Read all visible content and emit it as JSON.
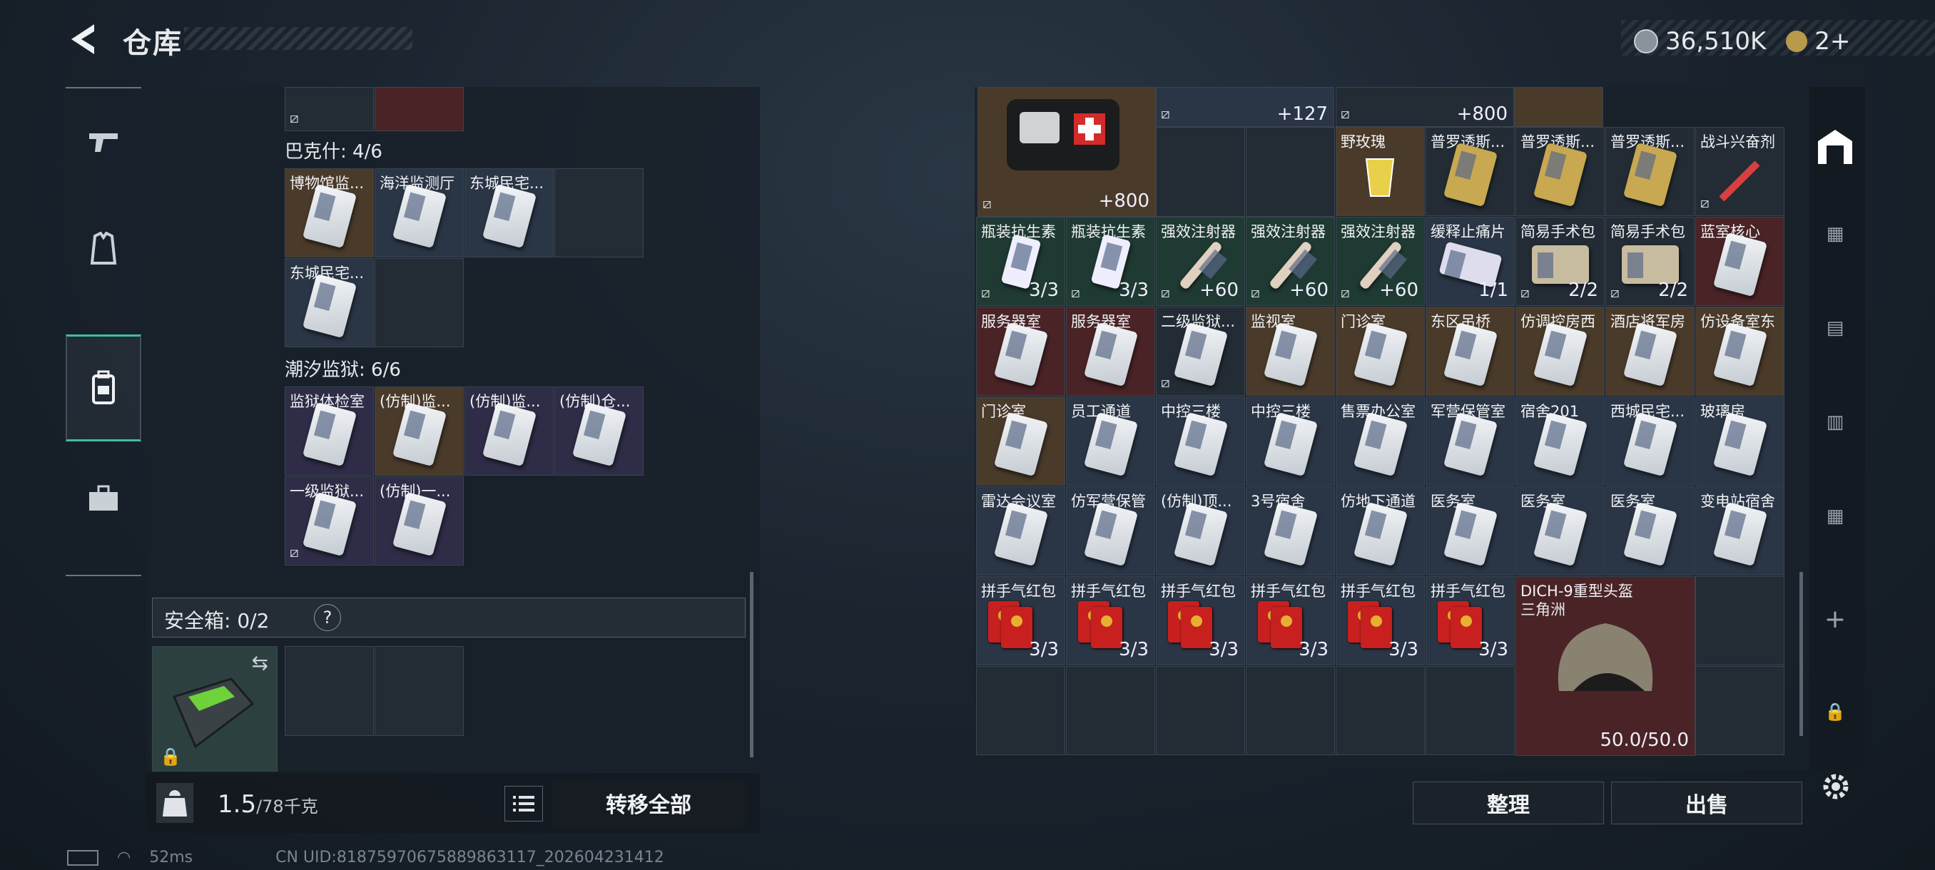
{
  "header": {
    "title": "仓库"
  },
  "currency": {
    "money": "36,510K",
    "tickets": "2+"
  },
  "left": {
    "bakeshi_label": "巴克什: 4/6",
    "bakeshi_items": [
      "博物馆监...",
      "海洋监测厅",
      "东城民宅...",
      "东城民宅..."
    ],
    "chaoxi_label": "潮汐监狱: 6/6",
    "chaoxi_items": [
      "监狱体检室",
      "(仿制)监...",
      "(仿制)监...",
      "(仿制)仓...",
      "一级监狱...",
      "(仿制)一..."
    ],
    "safebox_label": "安全箱: 0/2",
    "safebox_help": "?",
    "weight_value": "1.5",
    "weight_max": "/78千克",
    "transfer_all": "转移全部"
  },
  "right": {
    "top_counts": [
      "+800",
      "+127",
      "+800"
    ],
    "row1": [
      {
        "name": "野玫瑰",
        "count": ""
      },
      {
        "name": "普罗透斯...",
        "count": ""
      },
      {
        "name": "普罗透斯...",
        "count": ""
      },
      {
        "name": "普罗透斯...",
        "count": ""
      },
      {
        "name": "战斗兴奋剂",
        "count": ""
      }
    ],
    "row2": [
      {
        "name": "瓶装抗生素",
        "count": "3/3"
      },
      {
        "name": "瓶装抗生素",
        "count": "3/3"
      },
      {
        "name": "强效注射器",
        "count": "+60"
      },
      {
        "name": "强效注射器",
        "count": "+60"
      },
      {
        "name": "强效注射器",
        "count": "+60"
      },
      {
        "name": "缓释止痛片",
        "count": "1/1"
      },
      {
        "name": "简易手术包",
        "count": "2/2"
      },
      {
        "name": "简易手术包",
        "count": "2/2"
      },
      {
        "name": "蓝室核心",
        "count": ""
      }
    ],
    "row3": [
      "服务器室",
      "服务器室",
      "二级监狱...",
      "监视室",
      "门诊室",
      "东区吊桥",
      "仿调控房西",
      "酒店将军房",
      "仿设备室东"
    ],
    "row4": [
      "门诊室",
      "员工通道",
      "中控三楼",
      "中控三楼",
      "售票办公室",
      "军营保管室",
      "宿舍201",
      "西城民宅...",
      "玻璃房"
    ],
    "row5": [
      "雷达会议室",
      "仿军营保管",
      "(仿制)顶...",
      "3号宿舍",
      "仿地下通道",
      "医务室",
      "医务室",
      "医务室",
      "变电站宿舍"
    ],
    "row6": [
      {
        "name": "拼手气红包",
        "count": "3/3"
      },
      {
        "name": "拼手气红包",
        "count": "3/3"
      },
      {
        "name": "拼手气红包",
        "count": "3/3"
      },
      {
        "name": "拼手气红包",
        "count": "3/3"
      },
      {
        "name": "拼手气红包",
        "count": "3/3"
      },
      {
        "name": "拼手气红包",
        "count": "3/3"
      }
    ],
    "helmet": {
      "name": "DICH-9重型头盔",
      "sub": "三角洲",
      "durability": "50.0/50.0"
    },
    "sort_button": "整理",
    "sell_button": "出售"
  },
  "status": {
    "ping": "52ms",
    "uid": "CN UID:8187597067588986​3117_202604231412"
  },
  "colors": {
    "accent": "#3fbf9e",
    "rare_red": "#4a2326",
    "gold": "#e6b030"
  }
}
